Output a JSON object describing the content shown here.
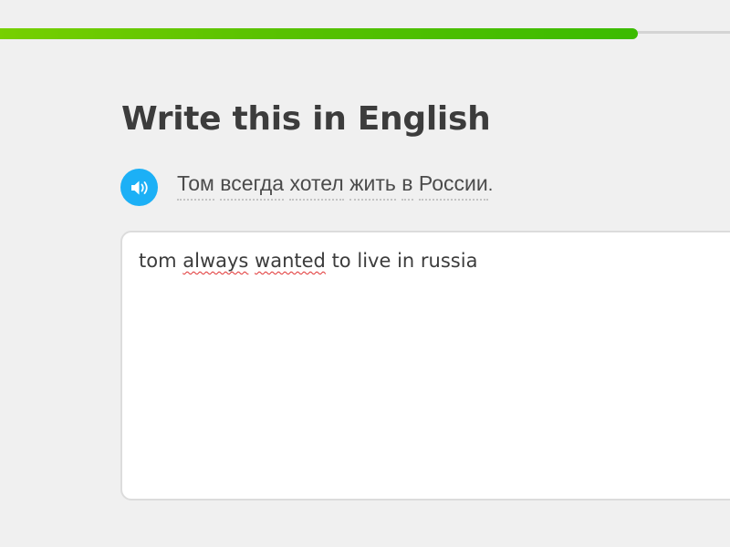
{
  "progress": {
    "fraction": 0.93,
    "colors": {
      "fill": "#58c100",
      "track": "#d4d4d4"
    }
  },
  "challenge": {
    "title": "Write this in English",
    "speaker_icon": "speaker-icon",
    "prompt_words": [
      "Том",
      "всегда",
      "хотел",
      "жить",
      "в",
      "России"
    ],
    "prompt_punctuation": ".",
    "answer": {
      "words": [
        {
          "text": "tom",
          "misspelled": false
        },
        {
          "text": "always",
          "misspelled": true
        },
        {
          "text": "wanted",
          "misspelled": true
        },
        {
          "text": "to",
          "misspelled": false
        },
        {
          "text": "live",
          "misspelled": false
        },
        {
          "text": "in",
          "misspelled": false
        },
        {
          "text": "russia",
          "misspelled": false
        }
      ]
    }
  },
  "colors": {
    "background": "#f0f0f0",
    "accent_blue": "#1cb0f6",
    "spellcheck_red": "#e03131"
  }
}
